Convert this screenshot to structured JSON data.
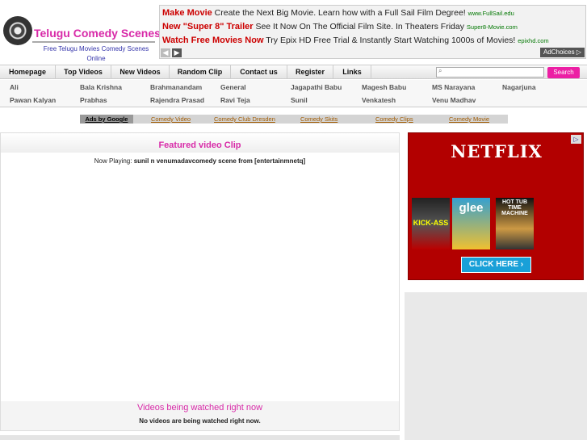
{
  "header": {
    "site_title": "Telugu Comedy Scenes",
    "tagline": "Free Telugu Movies Comedy Scenes Online",
    "ads": [
      {
        "head": "Make Movie",
        "text": "Create the Next Big Movie. Learn how with a Full Sail Film Degree!",
        "url": "www.FullSail.edu"
      },
      {
        "head": "New \"Super 8\" Trailer",
        "text": "See It Now On The Official Film Site. In Theaters Friday",
        "url": "Super8-Movie.com"
      },
      {
        "head": "Watch Free Movies Now",
        "text": "Try Epix HD Free Trial & Instantly Start Watching 1000s of Movies!",
        "url": "epixhd.com"
      }
    ],
    "ad_prev": "◀",
    "ad_next": "▶",
    "adchoices": "AdChoices ▷"
  },
  "nav": {
    "items": [
      "Homepage",
      "Top Videos",
      "New Videos",
      "Random Clip",
      "Contact us",
      "Register",
      "Links"
    ],
    "search_icon": "search-icon",
    "search_glyph": "⌕",
    "search_button": "Search"
  },
  "actors": [
    "Ali",
    "Bala Krishna",
    "Brahmanandam",
    "General",
    "Jagapathi Babu",
    "Magesh Babu",
    "MS Narayana",
    "Nagarjuna",
    "Pawan Kalyan",
    "Prabhas",
    "Rajendra Prasad",
    "Ravi Teja",
    "Sunil",
    "Venkatesh",
    "Venu Madhav"
  ],
  "ads_strip": {
    "label": "Ads by Google",
    "links": [
      "Comedy Video",
      "Comedy Club Dresden",
      "Comedy Skits",
      "Comedy Clips",
      "Comedy Movie"
    ]
  },
  "main": {
    "featured_title": "Featured video Clip",
    "now_playing_label": "Now Playing:",
    "now_playing_value": "sunil n venumadavcomedy scene from [entertainmnetq]",
    "watching_title": "Videos being watched right now",
    "watching_empty": "No videos are being watched right now."
  },
  "sidebar_ad": {
    "brand": "NETFLIX",
    "dvds": [
      "KICK-ASS",
      "glee",
      "HOT TUB TIME MACHINE"
    ],
    "cta": "CLICK HERE ›",
    "adchoice_glyph": "▷"
  },
  "colors": {
    "accent": "#d82aa8",
    "search_button": "#ec1fa4",
    "netflix_red": "#b20000",
    "cta_blue": "#19a0d8"
  }
}
